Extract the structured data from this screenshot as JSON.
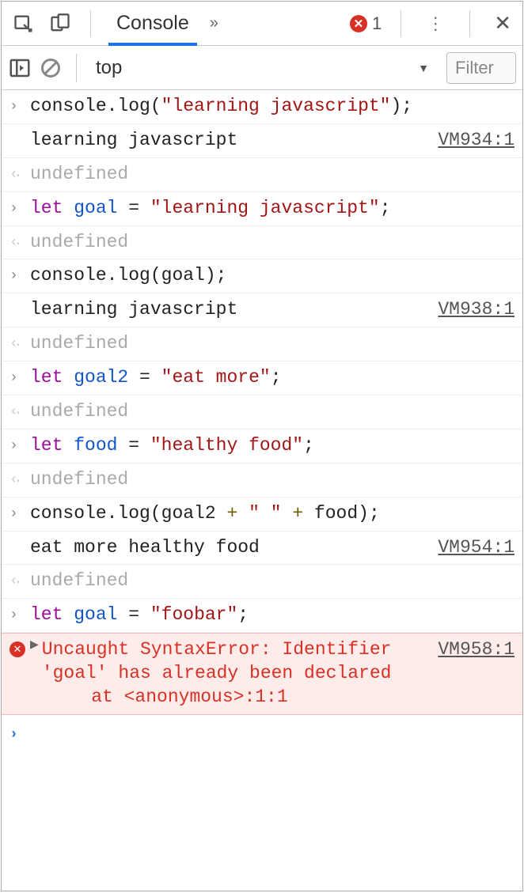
{
  "tabs": {
    "active": "Console",
    "error_count": "1"
  },
  "subbar": {
    "context": "top",
    "filter_placeholder": "Filter"
  },
  "rows": [
    {
      "kind": "input",
      "code": [
        {
          "t": "def",
          "v": "console.log"
        },
        {
          "t": "punc",
          "v": "("
        },
        {
          "t": "str",
          "v": "\"learning javascript\""
        },
        {
          "t": "punc",
          "v": ");"
        }
      ]
    },
    {
      "kind": "log",
      "msg": "learning javascript",
      "src": "VM934:1"
    },
    {
      "kind": "return",
      "value": "undefined"
    },
    {
      "kind": "input",
      "code": [
        {
          "t": "kw",
          "v": "let "
        },
        {
          "t": "var",
          "v": "goal"
        },
        {
          "t": "def",
          "v": " = "
        },
        {
          "t": "str",
          "v": "\"learning javascript\""
        },
        {
          "t": "punc",
          "v": ";"
        }
      ]
    },
    {
      "kind": "return",
      "value": "undefined"
    },
    {
      "kind": "input",
      "code": [
        {
          "t": "def",
          "v": "console.log"
        },
        {
          "t": "punc",
          "v": "("
        },
        {
          "t": "def",
          "v": "goal"
        },
        {
          "t": "punc",
          "v": ");"
        }
      ]
    },
    {
      "kind": "log",
      "msg": "learning javascript",
      "src": "VM938:1"
    },
    {
      "kind": "return",
      "value": "undefined"
    },
    {
      "kind": "input",
      "code": [
        {
          "t": "kw",
          "v": "let "
        },
        {
          "t": "var",
          "v": "goal2"
        },
        {
          "t": "def",
          "v": " = "
        },
        {
          "t": "str",
          "v": "\"eat more\""
        },
        {
          "t": "punc",
          "v": ";"
        }
      ]
    },
    {
      "kind": "return",
      "value": "undefined"
    },
    {
      "kind": "input",
      "code": [
        {
          "t": "kw",
          "v": "let "
        },
        {
          "t": "var",
          "v": "food"
        },
        {
          "t": "def",
          "v": " = "
        },
        {
          "t": "str",
          "v": "\"healthy food\""
        },
        {
          "t": "punc",
          "v": ";"
        }
      ]
    },
    {
      "kind": "return",
      "value": "undefined"
    },
    {
      "kind": "input",
      "code": [
        {
          "t": "def",
          "v": "console.log"
        },
        {
          "t": "punc",
          "v": "("
        },
        {
          "t": "def",
          "v": "goal2 "
        },
        {
          "t": "op",
          "v": "+"
        },
        {
          "t": "def",
          "v": " "
        },
        {
          "t": "str",
          "v": "\" \""
        },
        {
          "t": "def",
          "v": " "
        },
        {
          "t": "op",
          "v": "+"
        },
        {
          "t": "def",
          "v": " food"
        },
        {
          "t": "punc",
          "v": ");"
        }
      ]
    },
    {
      "kind": "log",
      "msg": "eat more healthy food",
      "src": "VM954:1"
    },
    {
      "kind": "return",
      "value": "undefined"
    },
    {
      "kind": "input",
      "code": [
        {
          "t": "kw",
          "v": "let "
        },
        {
          "t": "var",
          "v": "goal"
        },
        {
          "t": "def",
          "v": " = "
        },
        {
          "t": "str",
          "v": "\"foobar\""
        },
        {
          "t": "punc",
          "v": ";"
        }
      ]
    },
    {
      "kind": "error",
      "src": "VM958:1",
      "lines": [
        "Uncaught SyntaxError: Identifier 'goal' has already been declared",
        "    at <anonymous>:1:1"
      ]
    },
    {
      "kind": "prompt"
    }
  ]
}
